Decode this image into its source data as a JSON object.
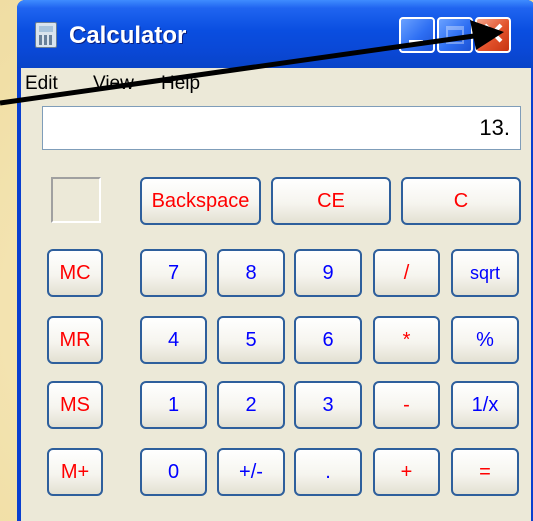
{
  "window": {
    "title": "Calculator"
  },
  "title_buttons": {
    "minimize": "minimize-icon",
    "maximize": "maximize-icon",
    "close": "close-icon"
  },
  "menu": {
    "items": [
      "Edit",
      "View",
      "Help"
    ]
  },
  "display": {
    "value": "13."
  },
  "buttons": {
    "backspace": "Backspace",
    "ce": "CE",
    "c": "C",
    "mc": "MC",
    "mr": "MR",
    "ms": "MS",
    "mplus": "M+",
    "d7": "7",
    "d8": "8",
    "d9": "9",
    "div": "/",
    "sqrt": "sqrt",
    "d4": "4",
    "d5": "5",
    "d6": "6",
    "mul": "*",
    "pct": "%",
    "d1": "1",
    "d2": "2",
    "d3": "3",
    "sub": "-",
    "recip": "1/x",
    "d0": "0",
    "sign": "+/-",
    "dot": ".",
    "add": "+",
    "eq": "="
  },
  "colors": {
    "titlebar": "#0a48d6",
    "operator": "#ff0000",
    "digit": "#0000ff",
    "annotation_arrow": "#000000"
  }
}
